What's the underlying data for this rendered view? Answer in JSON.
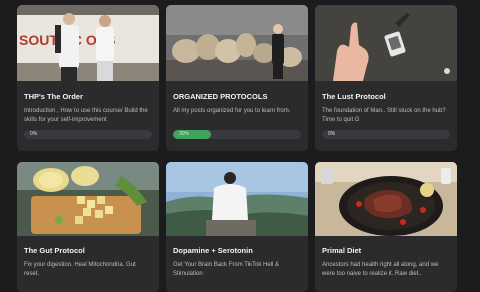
{
  "courses": [
    {
      "title": "THP's The Order",
      "description": "Introduction , How to use this course/ Build the skills for your self-improvement",
      "progress_label": "0%",
      "progress": 0,
      "sign_text": "SOUTH C     OSS"
    },
    {
      "title": "ORGANIZED PROTOCOLS",
      "description": "All my posts organized for you to learn from.",
      "progress_label": "30%",
      "progress": 30
    },
    {
      "title": "The Lust Protocol",
      "description": "The foundation of Man.. Still stuck on the hub? Time to quit G",
      "progress_label": "0%",
      "progress": 0
    },
    {
      "title": "The Gut Protocol",
      "description": "Fix your digestion. Heal Mitochondria. Gut reset."
    },
    {
      "title": "Dopamine + Serotonin",
      "description": "Get Your Brain Back From TikTok Hell & Stimulation"
    },
    {
      "title": "Primal Diet",
      "description": "Ancestors had health right all along, and we were too naive to realize it. Raw diet.."
    }
  ],
  "colors": {
    "background": "#1c1c1e",
    "card": "#2b2b2e",
    "progress_track": "#3a3a3e",
    "progress_fill": "#3fa35b"
  }
}
